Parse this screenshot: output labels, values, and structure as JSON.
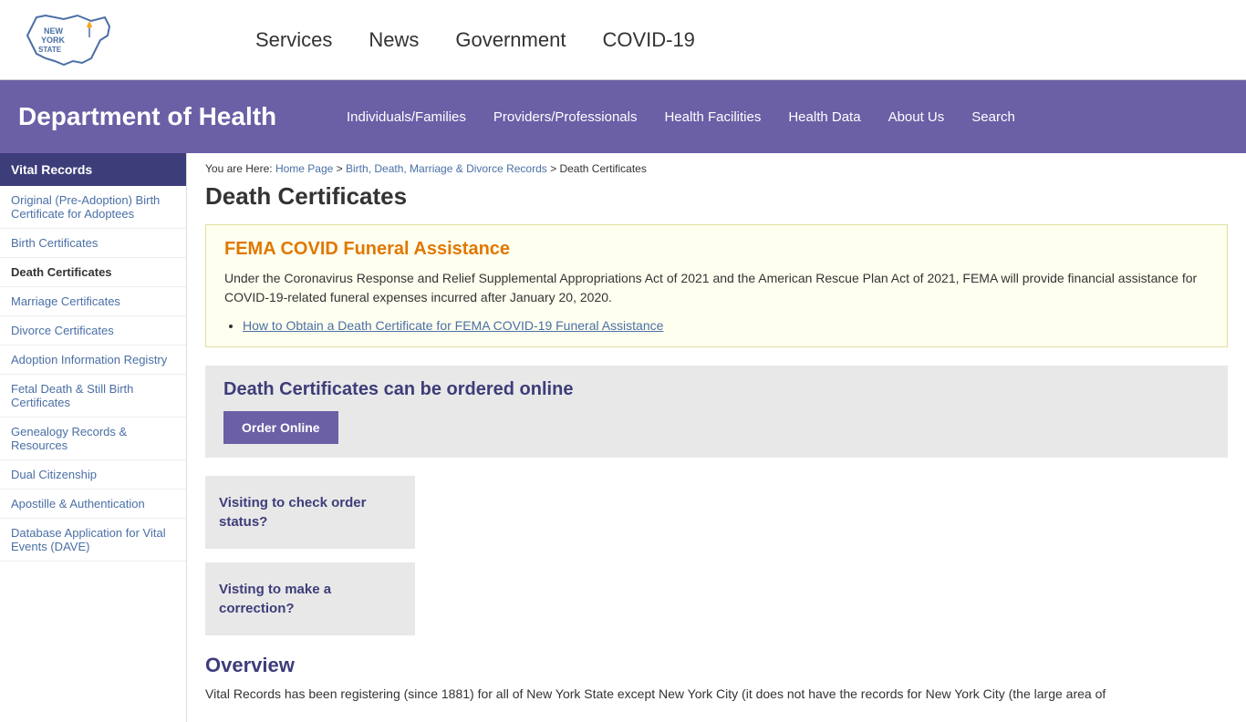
{
  "topNav": {
    "links": [
      {
        "label": "Services",
        "id": "services"
      },
      {
        "label": "News",
        "id": "news"
      },
      {
        "label": "Government",
        "id": "government"
      },
      {
        "label": "COVID-19",
        "id": "covid19"
      }
    ]
  },
  "deptHeader": {
    "title": "Department of Health",
    "navLinks": [
      {
        "label": "Individuals/Families"
      },
      {
        "label": "Providers/Professionals"
      },
      {
        "label": "Health Facilities"
      },
      {
        "label": "Health Data"
      },
      {
        "label": "About Us"
      },
      {
        "label": "Search"
      }
    ]
  },
  "sidebar": {
    "title": "Vital Records",
    "links": [
      {
        "label": "Original (Pre-Adoption) Birth Certificate for Adoptees",
        "active": false
      },
      {
        "label": "Birth Certificates",
        "active": false
      },
      {
        "label": "Death Certificates",
        "active": true
      },
      {
        "label": "Marriage Certificates",
        "active": false
      },
      {
        "label": "Divorce Certificates",
        "active": false
      },
      {
        "label": "Adoption Information Registry",
        "active": false
      },
      {
        "label": "Fetal Death & Still Birth Certificates",
        "active": false
      },
      {
        "label": "Genealogy Records & Resources",
        "active": false
      },
      {
        "label": "Dual Citizenship",
        "active": false
      },
      {
        "label": "Apostille & Authentication",
        "active": false
      },
      {
        "label": "Database Application for Vital Events (DAVE)",
        "active": false
      }
    ]
  },
  "breadcrumb": {
    "prefix": "You are Here:",
    "homeLabel": "Home Page",
    "bdmLabel": "Birth, Death, Marriage & Divorce Records",
    "current": "Death Certificates"
  },
  "pageTitle": "Death Certificates",
  "femaBox": {
    "title": "FEMA COVID Funeral Assistance",
    "text": "Under the Coronavirus Response and Relief Supplemental Appropriations Act of 2021 and the American Rescue Plan Act of 2021, FEMA will provide financial assistance for COVID-19-related funeral expenses incurred after January 20, 2020.",
    "linkLabel": "How to Obtain a Death Certificate for FEMA COVID-19 Funeral Assistance"
  },
  "orderSection": {
    "title": "Death Certificates can be ordered online",
    "buttonLabel": "Order Online"
  },
  "cards": [
    {
      "linkLabel": "Visiting to check order status?"
    },
    {
      "linkLabel": "Visting to make a correction?"
    }
  ],
  "overview": {
    "title": "Overview",
    "text": "Vital Records has been registering (since 1881) for all of New York State except New York City (it does not have the records for New York City (the large area of"
  }
}
